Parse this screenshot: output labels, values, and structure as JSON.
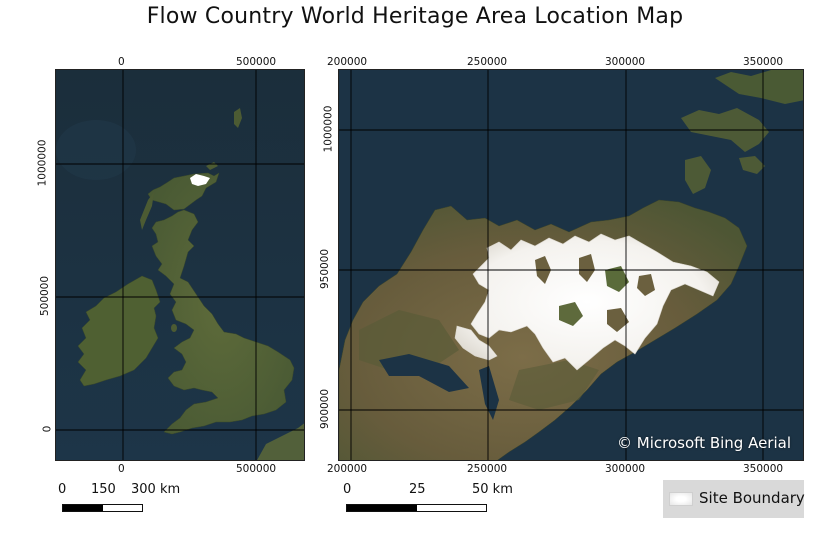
{
  "title": "Flow Country World Heritage Area Location Map",
  "left_map": {
    "x_ticks_top": [
      "0",
      "500000"
    ],
    "x_ticks_bottom": [
      "0",
      "500000"
    ],
    "y_ticks": [
      "1000000",
      "500000",
      "0"
    ],
    "scalebar": {
      "labels": [
        "0",
        "150",
        "300 km"
      ]
    }
  },
  "right_map": {
    "x_ticks_top": [
      "200000",
      "250000",
      "300000",
      "350000"
    ],
    "x_ticks_bottom": [
      "200000",
      "250000",
      "300000",
      "350000"
    ],
    "y_ticks": [
      "1000000",
      "950000",
      "900000"
    ],
    "credit": "© Microsoft Bing Aerial",
    "scalebar": {
      "labels": [
        "0",
        "25",
        "50 km"
      ]
    }
  },
  "legend": {
    "label": "Site Boundary"
  },
  "colors": {
    "sea": "#1c3345",
    "land_dark": "#4a5a35",
    "land_brown": "#7a6a48",
    "site": "#ffffff",
    "grid": "#000000"
  }
}
